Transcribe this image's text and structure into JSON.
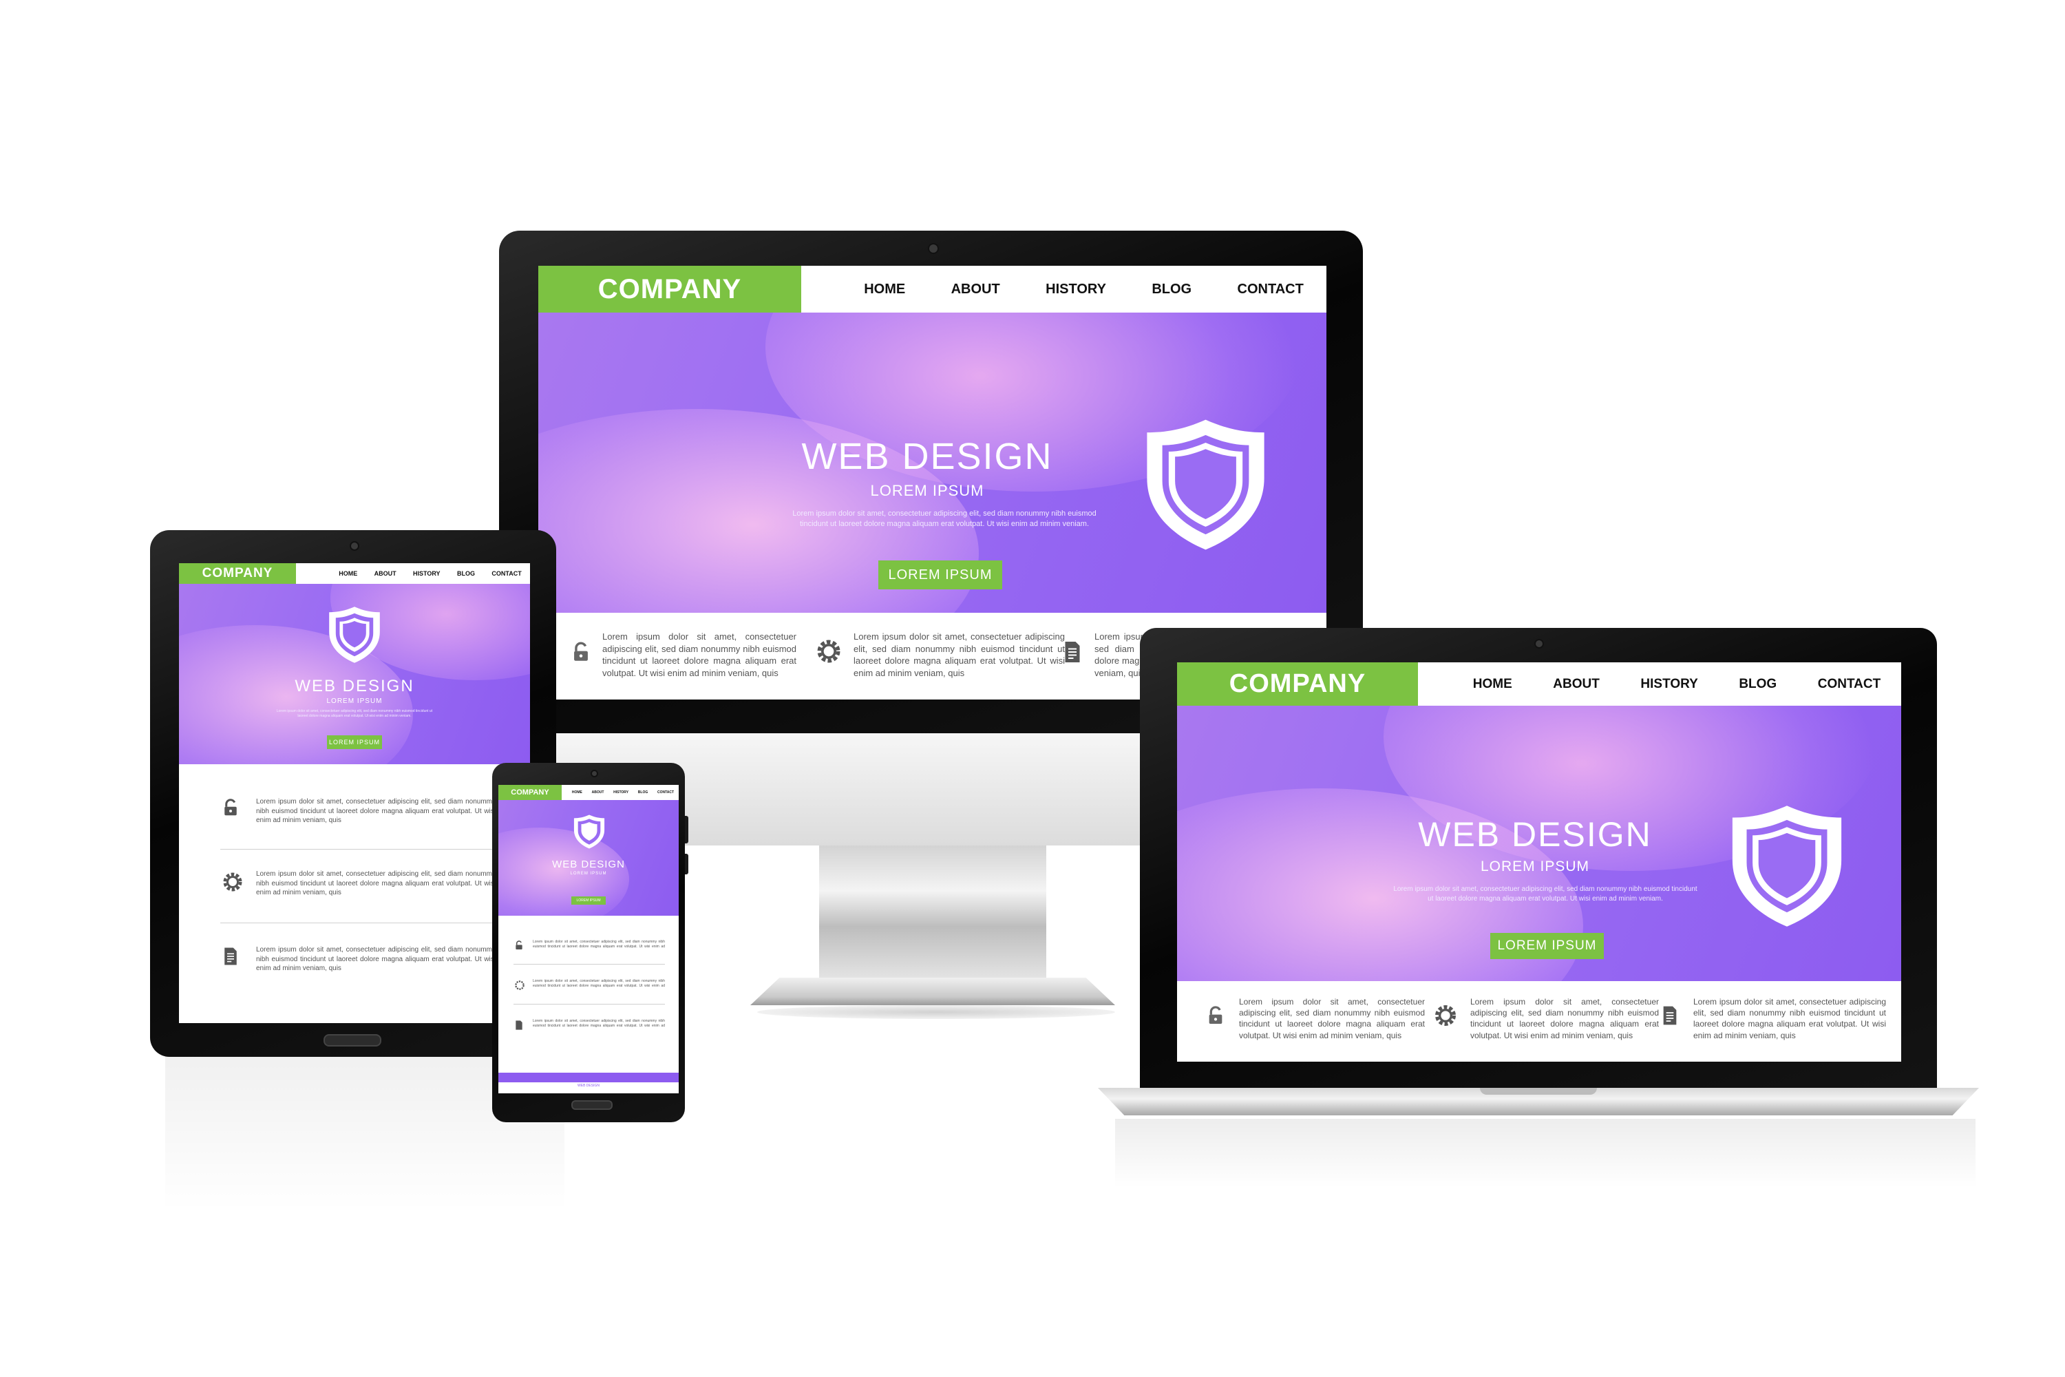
{
  "site": {
    "company": "COMPANY",
    "nav": [
      "HOME",
      "ABOUT",
      "HISTORY",
      "BLOG",
      "CONTACT"
    ],
    "hero_title": "WEB DESIGN",
    "hero_subtitle": "LOREM IPSUM",
    "hero_body": "Lorem ipsum dolor sit amet, consectetuer adipiscing elit, sed diam nonummy nibh euismod tincidunt ut laoreet dolore magna aliquam erat volutpat. Ut wisi enim ad minim veniam.",
    "cta": "LOREM IPSUM",
    "feature_text": "Lorem ipsum dolor sit amet, consectetuer adipiscing elit, sed diam nonummy nibh euismod tincidunt ut laoreet dolore magna aliquam erat volutpat. Ut wisi enim ad minim veniam, quis",
    "feature_text_short": "Lorem ipsum dolor sit amet, consectetuer adipiscing elit, sed diam nonummy nibh euismod tincidunt ut laoreet dolore magna aliquam erat volutpat. Ut wisi enim ad minim veniam, quis",
    "footer_label": "WEB DESIGN",
    "features": [
      {
        "icon": "lock-icon"
      },
      {
        "icon": "gear-icon"
      },
      {
        "icon": "document-icon"
      }
    ]
  },
  "colors": {
    "brand_green": "#7cc242",
    "hero_purple": "#9a6cf3",
    "bezel": "#0a0a0a"
  }
}
